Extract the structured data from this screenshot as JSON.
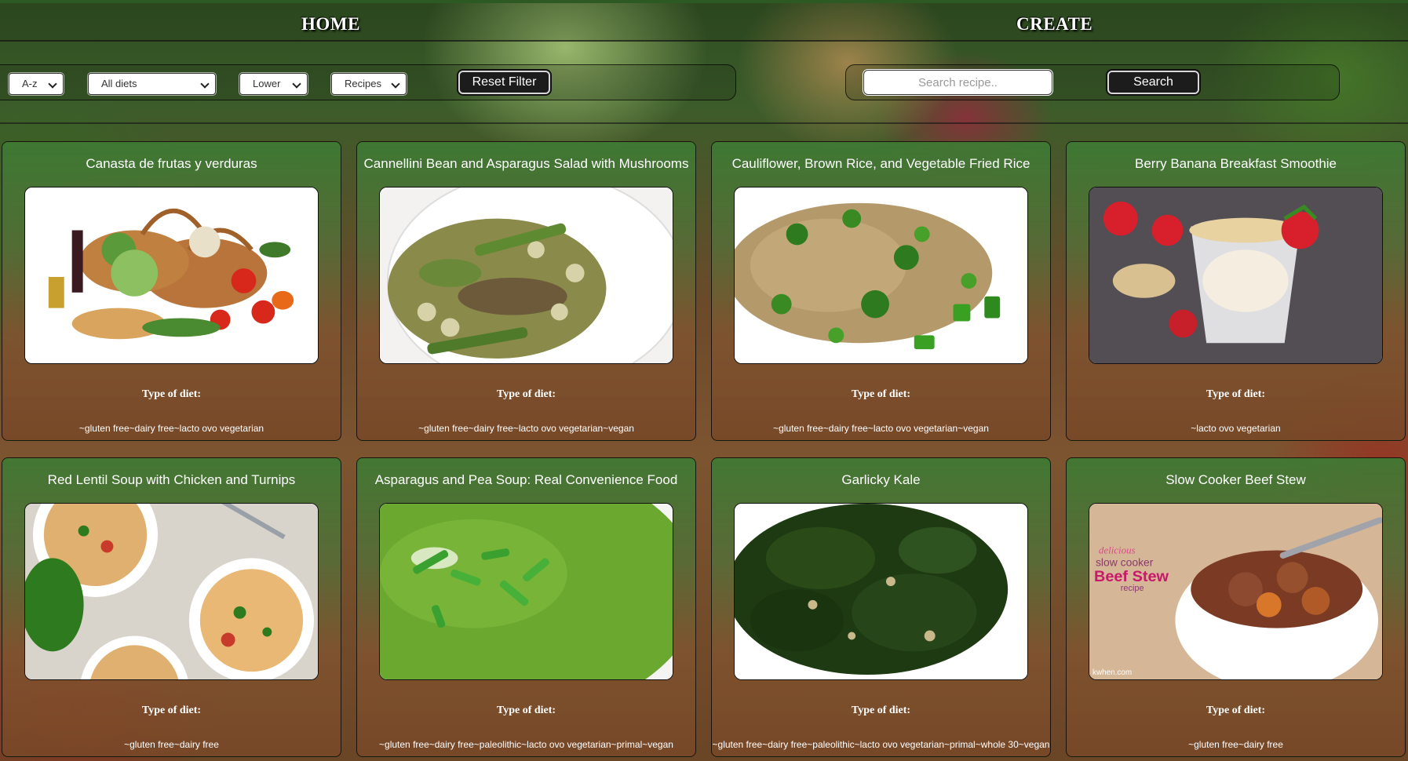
{
  "nav": {
    "home": "HOME",
    "create": "CREATE"
  },
  "filters": {
    "sort_order": "A-z",
    "diet": "All diets",
    "case": "Lower",
    "source": "Recipes",
    "reset_label": "Reset Filter"
  },
  "search": {
    "placeholder": "Search recipe..",
    "button_label": "Search"
  },
  "cards": [
    {
      "title": "Canasta de frutas y verduras",
      "image_icon": "vegetable-basket-photo",
      "diet_label": "Type of diet:",
      "diets": "~gluten free~dairy free~lacto ovo vegetarian"
    },
    {
      "title": "Cannellini Bean and Asparagus Salad with Mushrooms",
      "image_icon": "bean-asparagus-salad-photo",
      "diet_label": "Type of diet:",
      "diets": "~gluten free~dairy free~lacto ovo vegetarian~vegan"
    },
    {
      "title": "Cauliflower, Brown Rice, and Vegetable Fried Rice",
      "image_icon": "fried-rice-photo",
      "diet_label": "Type of diet:",
      "diets": "~gluten free~dairy free~lacto ovo vegetarian~vegan"
    },
    {
      "title": "Berry Banana Breakfast Smoothie",
      "image_icon": "smoothie-photo",
      "diet_label": "Type of diet:",
      "diets": "~lacto ovo vegetarian"
    },
    {
      "title": "Red Lentil Soup with Chicken and Turnips",
      "image_icon": "lentil-soup-photo",
      "diet_label": "Type of diet:",
      "diets": "~gluten free~dairy free"
    },
    {
      "title": "Asparagus and Pea Soup: Real Convenience Food",
      "image_icon": "pea-soup-photo",
      "diet_label": "Type of diet:",
      "diets": "~gluten free~dairy free~paleolithic~lacto ovo vegetarian~primal~vegan"
    },
    {
      "title": "Garlicky Kale",
      "image_icon": "kale-photo",
      "diet_label": "Type of diet:",
      "diets": "~gluten free~dairy free~paleolithic~lacto ovo vegetarian~primal~whole 30~vegan"
    },
    {
      "title": "Slow Cooker Beef Stew",
      "image_icon": "beef-stew-photo",
      "image_caption": {
        "line1": "delicious",
        "line2": "slow cooker",
        "line3": "Beef Stew",
        "line4": "recipe",
        "watermark": "kwhen.com"
      },
      "diet_label": "Type of diet:",
      "diets": "~gluten free~dairy free"
    }
  ]
}
